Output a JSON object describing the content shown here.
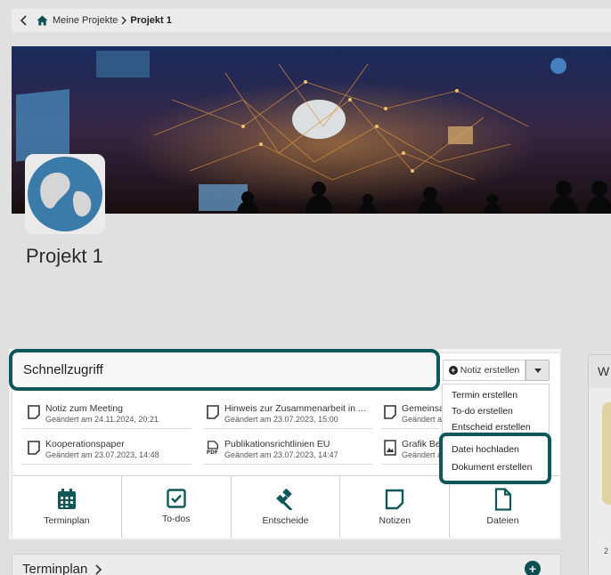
{
  "breadcrumb": {
    "items": [
      "Meine Projekte",
      "Projekt 1"
    ]
  },
  "project": {
    "title": "Projekt 1"
  },
  "quick_access": {
    "title": "Schnellzugriff",
    "new_note_button": "Notiz erstellen",
    "recent_items": [
      {
        "title": "Notiz zum Meeting",
        "subtitle": "Geändert am 24.11.2024, 20:21",
        "icon": "note-icon"
      },
      {
        "title": "Hinweis zur Zusammenarbeit in ...",
        "subtitle": "Geändert am 23.07.2023, 15:00",
        "icon": "note-icon"
      },
      {
        "title": "Gemeinsa",
        "subtitle": "Geändert a",
        "icon": "note-icon"
      },
      {
        "title": "Kooperationspaper",
        "subtitle": "Geändert am 23.07.2023, 14:48",
        "icon": "document-icon"
      },
      {
        "title": "Publikationsrichtlinien EU",
        "subtitle": "Geändert am 23.07.2023, 14:47",
        "icon": "pdf-icon"
      },
      {
        "title": "Grafik Be",
        "subtitle": "Geändert a",
        "icon": "image-icon"
      }
    ],
    "tiles": [
      {
        "label": "Terminplan",
        "icon": "calendar-icon"
      },
      {
        "label": "To-dos",
        "icon": "checkbox-icon"
      },
      {
        "label": "Entscheide",
        "icon": "gavel-icon"
      },
      {
        "label": "Notizen",
        "icon": "note-icon"
      },
      {
        "label": "Dateien",
        "icon": "file-icon"
      }
    ],
    "dropdown": {
      "items": [
        "Termin erstellen",
        "To-do erstellen",
        "Entscheid erstellen",
        "Datei hochladen",
        "Dokument erstellen"
      ]
    }
  },
  "side_card": {
    "title_partial": "W",
    "number_partial": "2"
  },
  "schedule_section": {
    "title": "Terminplan"
  },
  "colors": {
    "accent": "#10575a",
    "highlight_border": "#10575a"
  }
}
